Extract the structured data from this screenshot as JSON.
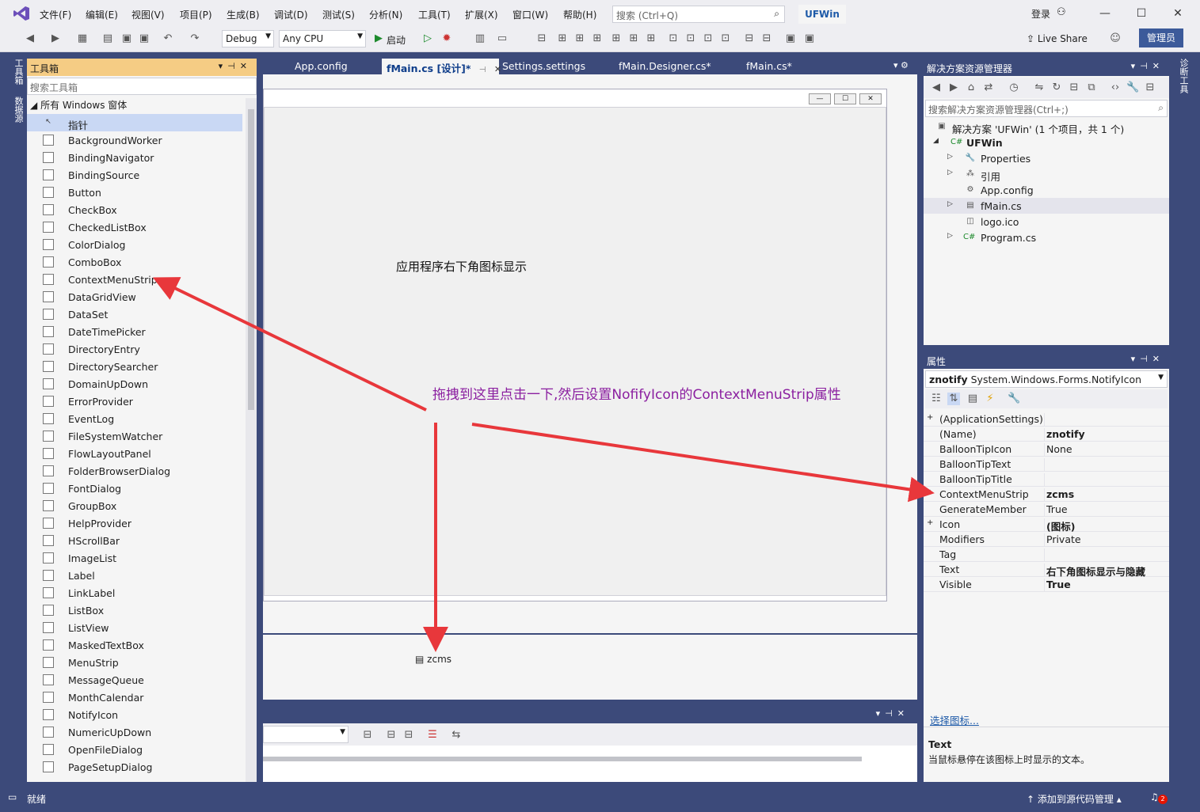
{
  "menubar": {
    "items": [
      "文件(F)",
      "编辑(E)",
      "视图(V)",
      "项目(P)",
      "生成(B)",
      "调试(D)",
      "测试(S)",
      "分析(N)",
      "工具(T)",
      "扩展(X)",
      "窗口(W)",
      "帮助(H)"
    ],
    "search_placeholder": "搜索 (Ctrl+Q)",
    "solution_name": "UFWin",
    "login": "登录"
  },
  "toolbar": {
    "config": "Debug",
    "platform": "Any CPU",
    "start": "启动",
    "live_share": "Live Share",
    "admin": "管理员"
  },
  "left_strip": {
    "tab1": "工具箱",
    "tab2": "数据源"
  },
  "toolbox": {
    "title": "工具箱",
    "search_placeholder": "搜索工具箱",
    "group": "所有 Windows 窗体",
    "items": [
      {
        "label": "指针",
        "icon": "pointer-icon"
      },
      {
        "label": "BackgroundWorker",
        "icon": "backgroundworker-icon"
      },
      {
        "label": "BindingNavigator",
        "icon": "bindingnavigator-icon"
      },
      {
        "label": "BindingSource",
        "icon": "bindingsource-icon"
      },
      {
        "label": "Button",
        "icon": "button-icon"
      },
      {
        "label": "CheckBox",
        "icon": "checkbox-icon"
      },
      {
        "label": "CheckedListBox",
        "icon": "checkedlistbox-icon"
      },
      {
        "label": "ColorDialog",
        "icon": "colordialog-icon"
      },
      {
        "label": "ComboBox",
        "icon": "combobox-icon"
      },
      {
        "label": "ContextMenuStrip",
        "icon": "contextmenustrip-icon"
      },
      {
        "label": "DataGridView",
        "icon": "datagridview-icon"
      },
      {
        "label": "DataSet",
        "icon": "dataset-icon"
      },
      {
        "label": "DateTimePicker",
        "icon": "datetimepicker-icon"
      },
      {
        "label": "DirectoryEntry",
        "icon": "directoryentry-icon"
      },
      {
        "label": "DirectorySearcher",
        "icon": "directorysearcher-icon"
      },
      {
        "label": "DomainUpDown",
        "icon": "domainupdown-icon"
      },
      {
        "label": "ErrorProvider",
        "icon": "errorprovider-icon"
      },
      {
        "label": "EventLog",
        "icon": "eventlog-icon"
      },
      {
        "label": "FileSystemWatcher",
        "icon": "filesystemwatcher-icon"
      },
      {
        "label": "FlowLayoutPanel",
        "icon": "flowlayoutpanel-icon"
      },
      {
        "label": "FolderBrowserDialog",
        "icon": "folderbrowserdialog-icon"
      },
      {
        "label": "FontDialog",
        "icon": "fontdialog-icon"
      },
      {
        "label": "GroupBox",
        "icon": "groupbox-icon"
      },
      {
        "label": "HelpProvider",
        "icon": "helpprovider-icon"
      },
      {
        "label": "HScrollBar",
        "icon": "hscrollbar-icon"
      },
      {
        "label": "ImageList",
        "icon": "imagelist-icon"
      },
      {
        "label": "Label",
        "icon": "label-icon"
      },
      {
        "label": "LinkLabel",
        "icon": "linklabel-icon"
      },
      {
        "label": "ListBox",
        "icon": "listbox-icon"
      },
      {
        "label": "ListView",
        "icon": "listview-icon"
      },
      {
        "label": "MaskedTextBox",
        "icon": "maskedtextbox-icon"
      },
      {
        "label": "MenuStrip",
        "icon": "menustrip-icon"
      },
      {
        "label": "MessageQueue",
        "icon": "messagequeue-icon"
      },
      {
        "label": "MonthCalendar",
        "icon": "monthcalendar-icon"
      },
      {
        "label": "NotifyIcon",
        "icon": "notifyicon-icon"
      },
      {
        "label": "NumericUpDown",
        "icon": "numericupdown-icon"
      },
      {
        "label": "OpenFileDialog",
        "icon": "openfiledialog-icon"
      },
      {
        "label": "PageSetupDialog",
        "icon": "pagesetupdialog-icon"
      }
    ]
  },
  "doc_tabs": [
    "App.config",
    "fMain.cs [设计]*",
    "Settings.settings",
    "fMain.Designer.cs*",
    "fMain.cs*"
  ],
  "designer": {
    "form_label": "应用程序右下角图标显示",
    "tray_item": "zcms",
    "annotation": "拖拽到这里点击一下,然后设置NofifyIcon的ContextMenuStrip属性"
  },
  "solution_explorer": {
    "title": "解决方案资源管理器",
    "search_placeholder": "搜索解决方案资源管理器(Ctrl+;)",
    "solution_line": "解决方案 'UFWin' (1 个项目，共 1 个)",
    "project": "UFWin",
    "items": [
      "Properties",
      "引用",
      "App.config",
      "fMain.cs",
      "logo.ico",
      "Program.cs"
    ]
  },
  "properties": {
    "title": "属性",
    "object_name": "znotify",
    "object_type": "System.Windows.Forms.NotifyIcon",
    "rows": [
      {
        "name": "(ApplicationSettings)",
        "value": "",
        "expand": "+",
        "bold": false
      },
      {
        "name": "(Name)",
        "value": "znotify",
        "expand": "",
        "bold": true
      },
      {
        "name": "BalloonTipIcon",
        "value": "None",
        "expand": "",
        "bold": false
      },
      {
        "name": "BalloonTipText",
        "value": "",
        "expand": "",
        "bold": false
      },
      {
        "name": "BalloonTipTitle",
        "value": "",
        "expand": "",
        "bold": false
      },
      {
        "name": "ContextMenuStrip",
        "value": "zcms",
        "expand": "+",
        "bold": true
      },
      {
        "name": "GenerateMember",
        "value": "True",
        "expand": "",
        "bold": false
      },
      {
        "name": "Icon",
        "value": "(图标)",
        "expand": "+",
        "bold": true
      },
      {
        "name": "Modifiers",
        "value": "Private",
        "expand": "",
        "bold": false
      },
      {
        "name": "Tag",
        "value": "",
        "expand": "",
        "bold": false
      },
      {
        "name": "Text",
        "value": "右下角图标显示与隐藏",
        "expand": "",
        "bold": true
      },
      {
        "name": "Visible",
        "value": "True",
        "expand": "",
        "bold": true
      }
    ],
    "link": "选择图标...",
    "desc_title": "Text",
    "desc_text": "当鼠标悬停在该图标上时显示的文本。"
  },
  "right_strip": {
    "tab": "诊断工具"
  },
  "status": {
    "ready": "就绪",
    "source_control": "添加到源代码管理",
    "notifications": "2"
  },
  "colors": {
    "accent": "#3c4a7a",
    "toolbox_title": "#f5cc84",
    "annotation": "#8b1fa0",
    "arrow": "#e8373b"
  }
}
